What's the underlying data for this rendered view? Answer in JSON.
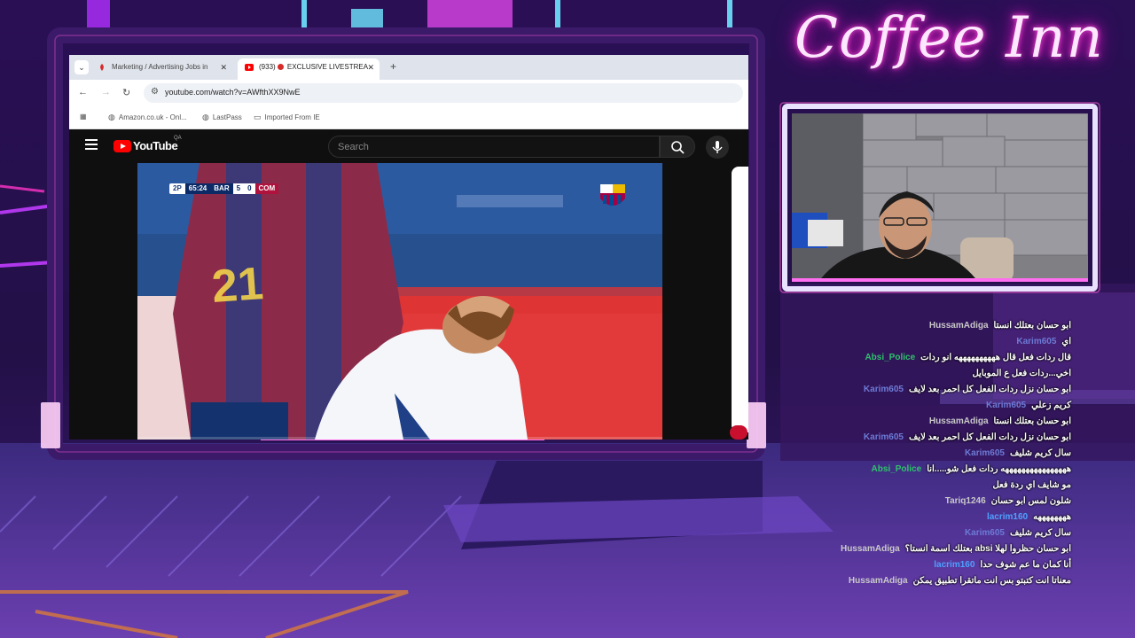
{
  "overlay": {
    "title": "Coffee Inn"
  },
  "browser": {
    "tabs": [
      {
        "label": "Marketing / Advertising Jobs in",
        "active": false
      },
      {
        "label": "(933)",
        "label_suffix": "EXCLUSIVE LIVESTREA",
        "active": true
      }
    ],
    "url": "youtube.com/watch?v=AWfthXX9NwE",
    "bookmarks": [
      {
        "icon": "amazon-icon",
        "label": "Amazon.co.uk - Onl..."
      },
      {
        "icon": "lastpass-icon",
        "label": "LastPass"
      },
      {
        "icon": "folder-icon",
        "label": "Imported From IE"
      }
    ]
  },
  "youtube": {
    "logo_text": "YouTube",
    "region": "QA",
    "search_placeholder": "Search"
  },
  "video": {
    "scorebug": {
      "period": "2P",
      "clock": "65:24",
      "home": "BAR",
      "home_score": "5",
      "away_score": "0",
      "away": "COM"
    },
    "jersey_number": "21"
  },
  "chat": {
    "colors": {
      "HussamAdiga": "#c9c9c9",
      "Karim605": "#6d7bd6",
      "Absi_Police": "#2ec26a",
      "Tariq1246": "#c9c9c9",
      "lacrim160": "#4fa0ff"
    },
    "messages": [
      {
        "user": "HussamAdiga",
        "text": "ابو حسان بعتلك انستا"
      },
      {
        "user": "Karim605",
        "text": "اي"
      },
      {
        "user": "Absi_Police",
        "text": "قال ردات فعل قال ههههههههههه انو ردات"
      },
      {
        "user": "",
        "text": "اخي...ردات فعل ع الموبايل"
      },
      {
        "user": "Karim605",
        "text": "ابو حسان نزل ردات الفعل كل احمر بعد لايف"
      },
      {
        "user": "Karim605",
        "text": "كريم زعلي"
      },
      {
        "user": "HussamAdiga",
        "text": "ابو حسان بعتلك انستا"
      },
      {
        "user": "Karim605",
        "text": "ابو حسان نزل ردات الفعل كل احمر بعد لايف"
      },
      {
        "user": "Karim605",
        "text": "سال كريم شليف"
      },
      {
        "user": "Absi_Police",
        "text": "ههههههههههههههههه ردات فعل شو.....انا"
      },
      {
        "user": "",
        "text": "مو شايف اي ردة فعل"
      },
      {
        "user": "Tariq1246",
        "text": "شلون لمس ابو حسان"
      },
      {
        "user": "lacrim160",
        "text": "ههههههههه"
      },
      {
        "user": "Karim605",
        "text": "سال كريم شليف"
      },
      {
        "user": "HussamAdiga",
        "text": "ابو حسان حظروا لهلا absi بعتلك اسمة انستا؟"
      },
      {
        "user": "lacrim160",
        "text": "أنا كمان ما عم شوف حدا"
      },
      {
        "user": "HussamAdiga",
        "text": "معناتا انت كتبتو بس انت ماتقرا تطبيق يمكن"
      }
    ]
  }
}
